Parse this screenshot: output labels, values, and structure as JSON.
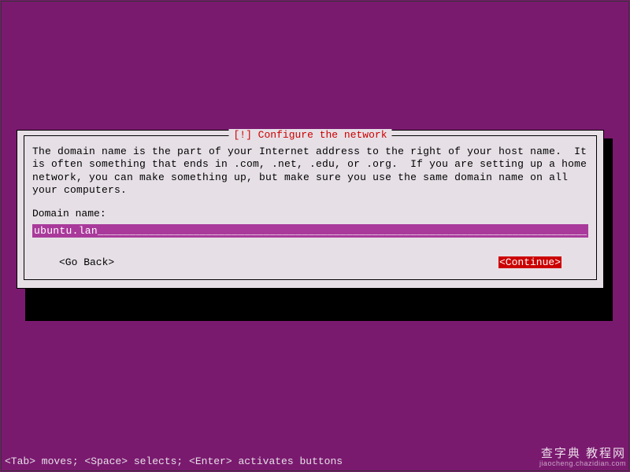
{
  "dialog": {
    "title": "[!] Configure the network",
    "body": "The domain name is the part of your Internet address to the right of your host name.  It is often something that ends in .com, .net, .edu, or .org.  If you are setting up a home network, you can make something up, but make sure you use the same domain name on all your computers.",
    "field_label": "Domain name:",
    "input_value": "ubuntu.lan_______________________________________________________________________________",
    "go_back_label": "<Go Back>",
    "continue_label": "<Continue>"
  },
  "statusbar": {
    "hint": "<Tab> moves; <Space> selects; <Enter> activates buttons"
  },
  "watermark": {
    "line1": "查字典 教程网",
    "line2": "jiaocheng.chazidian.com"
  }
}
